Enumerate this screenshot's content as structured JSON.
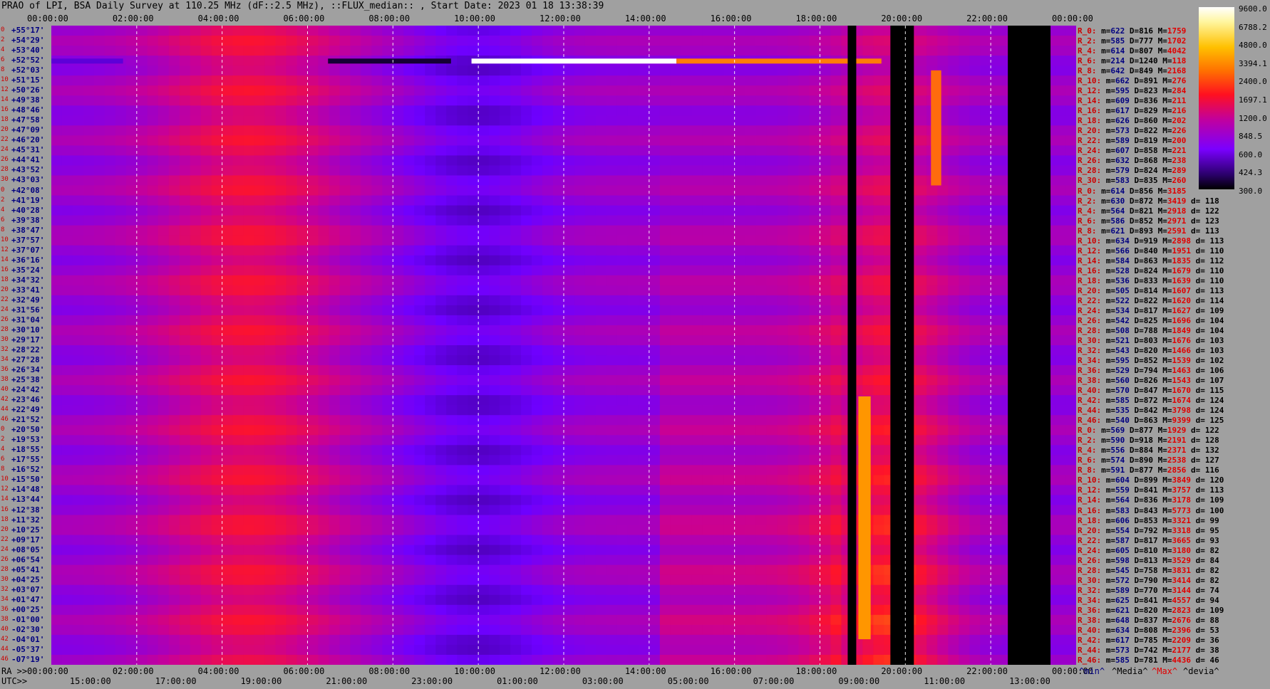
{
  "title": "PRAO of LPI, BSA Daily Survey at 110.25 MHz (dF::2.5 MHz), ::FLUX_median:: , Start Date: 2023 01 18 13:38:39",
  "chart_data": {
    "type": "heatmap",
    "title": "PRAO of LPI, BSA Daily Survey at 110.25 MHz (dF::2.5 MHz), ::FLUX_median:: , Start Date: 2023 01 18 13:38:39",
    "top_ticks": [
      "00:00:00",
      "02:00:00",
      "04:00:00",
      "06:00:00",
      "08:00:00",
      "10:00:00",
      "12:00:00",
      "14:00:00",
      "16:00:00",
      "18:00:00",
      "20:00:00",
      "22:00:00",
      "00:00:00"
    ],
    "bottom_ra_label": "RA >>",
    "bottom_ra_ticks": [
      "00:00:00",
      "02:00:00",
      "04:00:00",
      "06:00:00",
      "08:00:00",
      "10:00:00",
      "12:00:00",
      "14:00:00",
      "16:00:00",
      "18:00:00",
      "20:00:00",
      "22:00:00",
      "00:00:00"
    ],
    "bottom_utc_label": "UTC>>",
    "bottom_utc_ticks": [
      "15:00:00",
      "17:00:00",
      "19:00:00",
      "21:00:00",
      "23:00:00",
      "01:00:00",
      "03:00:00",
      "05:00:00",
      "07:00:00",
      "09:00:00",
      "11:00:00",
      "13:00:00"
    ],
    "beam_indices": [
      "0",
      "2",
      "4",
      "6",
      "8",
      "10",
      "12",
      "14",
      "16",
      "18",
      "20",
      "22",
      "24",
      "26",
      "28",
      "30",
      "0",
      "2",
      "4",
      "6",
      "8",
      "10",
      "12",
      "14",
      "16",
      "18",
      "20",
      "22",
      "24",
      "26",
      "28",
      "30",
      "32",
      "34",
      "36",
      "38",
      "40",
      "42",
      "44",
      "46",
      "0",
      "2",
      "4",
      "6",
      "8",
      "10",
      "12",
      "14",
      "16",
      "18",
      "20",
      "22",
      "24",
      "26",
      "28",
      "30",
      "32",
      "34",
      "36",
      "38",
      "40",
      "42",
      "44",
      "46"
    ],
    "declinations": [
      "+55°17'",
      "+54°29'",
      "+53°40'",
      "+52°52'",
      "+52°03'",
      "+51°15'",
      "+50°26'",
      "+49°38'",
      "+48°46'",
      "+47°58'",
      "+47°09'",
      "+46°20'",
      "+45°31'",
      "+44°41'",
      "+43°52'",
      "+43°03'",
      "+42°08'",
      "+41°19'",
      "+40°28'",
      "+39°38'",
      "+38°47'",
      "+37°57'",
      "+37°07'",
      "+36°16'",
      "+35°24'",
      "+34°32'",
      "+33°41'",
      "+32°49'",
      "+31°56'",
      "+31°04'",
      "+30°10'",
      "+29°17'",
      "+28°22'",
      "+27°28'",
      "+26°34'",
      "+25°38'",
      "+24°42'",
      "+23°46'",
      "+22°49'",
      "+21°52'",
      "+20°50'",
      "+19°53'",
      "+18°55'",
      "+17°55'",
      "+16°52'",
      "+15°50'",
      "+14°48'",
      "+13°44'",
      "+12°38'",
      "+11°32'",
      "+10°25'",
      "+09°17'",
      "+08°05'",
      "+06°54'",
      "+05°41'",
      "+04°25'",
      "+03°07'",
      "+01°47'",
      "+00°25'",
      "-01°00'",
      "-02°30'",
      "-04°01'",
      "-05°37'",
      "-07°19'"
    ],
    "colorbar_ticks": [
      "9600.0",
      "6788.2",
      "4800.0",
      "3394.1",
      "2400.0",
      "1697.1",
      "1200.0",
      "848.5",
      "600.0",
      "424.3",
      "300.0"
    ],
    "stats": [
      {
        "r": "R_0:",
        "min": "622",
        "med": "816",
        "max": "1759",
        "d": ""
      },
      {
        "r": "R_2:",
        "min": "585",
        "med": "777",
        "max": "1702",
        "d": ""
      },
      {
        "r": "R_4:",
        "min": "614",
        "med": "807",
        "max": "4042",
        "d": ""
      },
      {
        "r": "R_6:",
        "min": "214",
        "med": "1240",
        "max": "118",
        "d": ""
      },
      {
        "r": "R_8:",
        "min": "642",
        "med": "849",
        "max": "2168",
        "d": ""
      },
      {
        "r": "R_10:",
        "min": "662",
        "med": "891",
        "max": "276",
        "d": ""
      },
      {
        "r": "R_12:",
        "min": "595",
        "med": "823",
        "max": "284",
        "d": ""
      },
      {
        "r": "R_14:",
        "min": "609",
        "med": "836",
        "max": "211",
        "d": ""
      },
      {
        "r": "R_16:",
        "min": "617",
        "med": "829",
        "max": "216",
        "d": ""
      },
      {
        "r": "R_18:",
        "min": "626",
        "med": "860",
        "max": "202",
        "d": ""
      },
      {
        "r": "R_20:",
        "min": "573",
        "med": "822",
        "max": "226",
        "d": ""
      },
      {
        "r": "R_22:",
        "min": "589",
        "med": "819",
        "max": "200",
        "d": ""
      },
      {
        "r": "R_24:",
        "min": "607",
        "med": "858",
        "max": "221",
        "d": ""
      },
      {
        "r": "R_26:",
        "min": "632",
        "med": "868",
        "max": "238",
        "d": ""
      },
      {
        "r": "R_28:",
        "min": "579",
        "med": "824",
        "max": "289",
        "d": ""
      },
      {
        "r": "R_30:",
        "min": "583",
        "med": "835",
        "max": "260",
        "d": ""
      },
      {
        "r": "R_0:",
        "min": "614",
        "med": "856",
        "max": "3185",
        "d": ""
      },
      {
        "r": "R_2:",
        "min": "630",
        "med": "872",
        "max": "3419",
        "d": "118"
      },
      {
        "r": "R_4:",
        "min": "564",
        "med": "821",
        "max": "2918",
        "d": "122"
      },
      {
        "r": "R_6:",
        "min": "586",
        "med": "852",
        "max": "2971",
        "d": "123"
      },
      {
        "r": "R_8:",
        "min": "621",
        "med": "893",
        "max": "2591",
        "d": "113"
      },
      {
        "r": "R_10:",
        "min": "634",
        "med": "919",
        "max": "2898",
        "d": "113"
      },
      {
        "r": "R_12:",
        "min": "566",
        "med": "840",
        "max": "1951",
        "d": "110"
      },
      {
        "r": "R_14:",
        "min": "584",
        "med": "863",
        "max": "1835",
        "d": "112"
      },
      {
        "r": "R_16:",
        "min": "528",
        "med": "824",
        "max": "1679",
        "d": "110"
      },
      {
        "r": "R_18:",
        "min": "536",
        "med": "833",
        "max": "1639",
        "d": "110"
      },
      {
        "r": "R_20:",
        "min": "505",
        "med": "814",
        "max": "1607",
        "d": "113"
      },
      {
        "r": "R_22:",
        "min": "522",
        "med": "822",
        "max": "1620",
        "d": "114"
      },
      {
        "r": "R_24:",
        "min": "534",
        "med": "817",
        "max": "1627",
        "d": "109"
      },
      {
        "r": "R_26:",
        "min": "542",
        "med": "825",
        "max": "1696",
        "d": "104"
      },
      {
        "r": "R_28:",
        "min": "508",
        "med": "788",
        "max": "1849",
        "d": "104"
      },
      {
        "r": "R_30:",
        "min": "521",
        "med": "803",
        "max": "1676",
        "d": "103"
      },
      {
        "r": "R_32:",
        "min": "543",
        "med": "820",
        "max": "1466",
        "d": "103"
      },
      {
        "r": "R_34:",
        "min": "595",
        "med": "852",
        "max": "1539",
        "d": "102"
      },
      {
        "r": "R_36:",
        "min": "529",
        "med": "794",
        "max": "1463",
        "d": "106"
      },
      {
        "r": "R_38:",
        "min": "560",
        "med": "826",
        "max": "1543",
        "d": "107"
      },
      {
        "r": "R_40:",
        "min": "570",
        "med": "847",
        "max": "1670",
        "d": "115"
      },
      {
        "r": "R_42:",
        "min": "585",
        "med": "872",
        "max": "1674",
        "d": "124"
      },
      {
        "r": "R_44:",
        "min": "535",
        "med": "842",
        "max": "3798",
        "d": "124"
      },
      {
        "r": "R_46:",
        "min": "540",
        "med": "863",
        "max": "9399",
        "d": "125"
      },
      {
        "r": "R_0:",
        "min": "569",
        "med": "877",
        "max": "1929",
        "d": "122"
      },
      {
        "r": "R_2:",
        "min": "590",
        "med": "918",
        "max": "2191",
        "d": "128"
      },
      {
        "r": "R_4:",
        "min": "556",
        "med": "884",
        "max": "2371",
        "d": "132"
      },
      {
        "r": "R_6:",
        "min": "574",
        "med": "890",
        "max": "2538",
        "d": "127"
      },
      {
        "r": "R_8:",
        "min": "591",
        "med": "877",
        "max": "2856",
        "d": "116"
      },
      {
        "r": "R_10:",
        "min": "604",
        "med": "899",
        "max": "3849",
        "d": "120"
      },
      {
        "r": "R_12:",
        "min": "559",
        "med": "841",
        "max": "3757",
        "d": "113"
      },
      {
        "r": "R_14:",
        "min": "564",
        "med": "836",
        "max": "3178",
        "d": "109"
      },
      {
        "r": "R_16:",
        "min": "583",
        "med": "843",
        "max": "5773",
        "d": "100"
      },
      {
        "r": "R_18:",
        "min": "606",
        "med": "853",
        "max": "3321",
        "d": "99"
      },
      {
        "r": "R_20:",
        "min": "554",
        "med": "792",
        "max": "3318",
        "d": "95"
      },
      {
        "r": "R_22:",
        "min": "587",
        "med": "817",
        "max": "3665",
        "d": "93"
      },
      {
        "r": "R_24:",
        "min": "605",
        "med": "810",
        "max": "3180",
        "d": "82"
      },
      {
        "r": "R_26:",
        "min": "598",
        "med": "813",
        "max": "3529",
        "d": "84"
      },
      {
        "r": "R_28:",
        "min": "545",
        "med": "758",
        "max": "3831",
        "d": "82"
      },
      {
        "r": "R_30:",
        "min": "572",
        "med": "790",
        "max": "3414",
        "d": "82"
      },
      {
        "r": "R_32:",
        "min": "589",
        "med": "770",
        "max": "3144",
        "d": "74"
      },
      {
        "r": "R_34:",
        "min": "625",
        "med": "841",
        "max": "4557",
        "d": "94"
      },
      {
        "r": "R_36:",
        "min": "621",
        "med": "820",
        "max": "2823",
        "d": "109"
      },
      {
        "r": "R_38:",
        "min": "648",
        "med": "837",
        "max": "2676",
        "d": "88"
      },
      {
        "r": "R_40:",
        "min": "634",
        "med": "808",
        "max": "2396",
        "d": "53"
      },
      {
        "r": "R_42:",
        "min": "617",
        "med": "785",
        "max": "2209",
        "d": "36"
      },
      {
        "r": "R_44:",
        "min": "573",
        "med": "742",
        "max": "2177",
        "d": "38"
      },
      {
        "r": "R_46:",
        "min": "585",
        "med": "781",
        "max": "4436",
        "d": "46"
      }
    ],
    "footer_legend": {
      "min": "^min^",
      "med": "^Media^",
      "max": "^Max^",
      "dev": "^devia^"
    }
  }
}
